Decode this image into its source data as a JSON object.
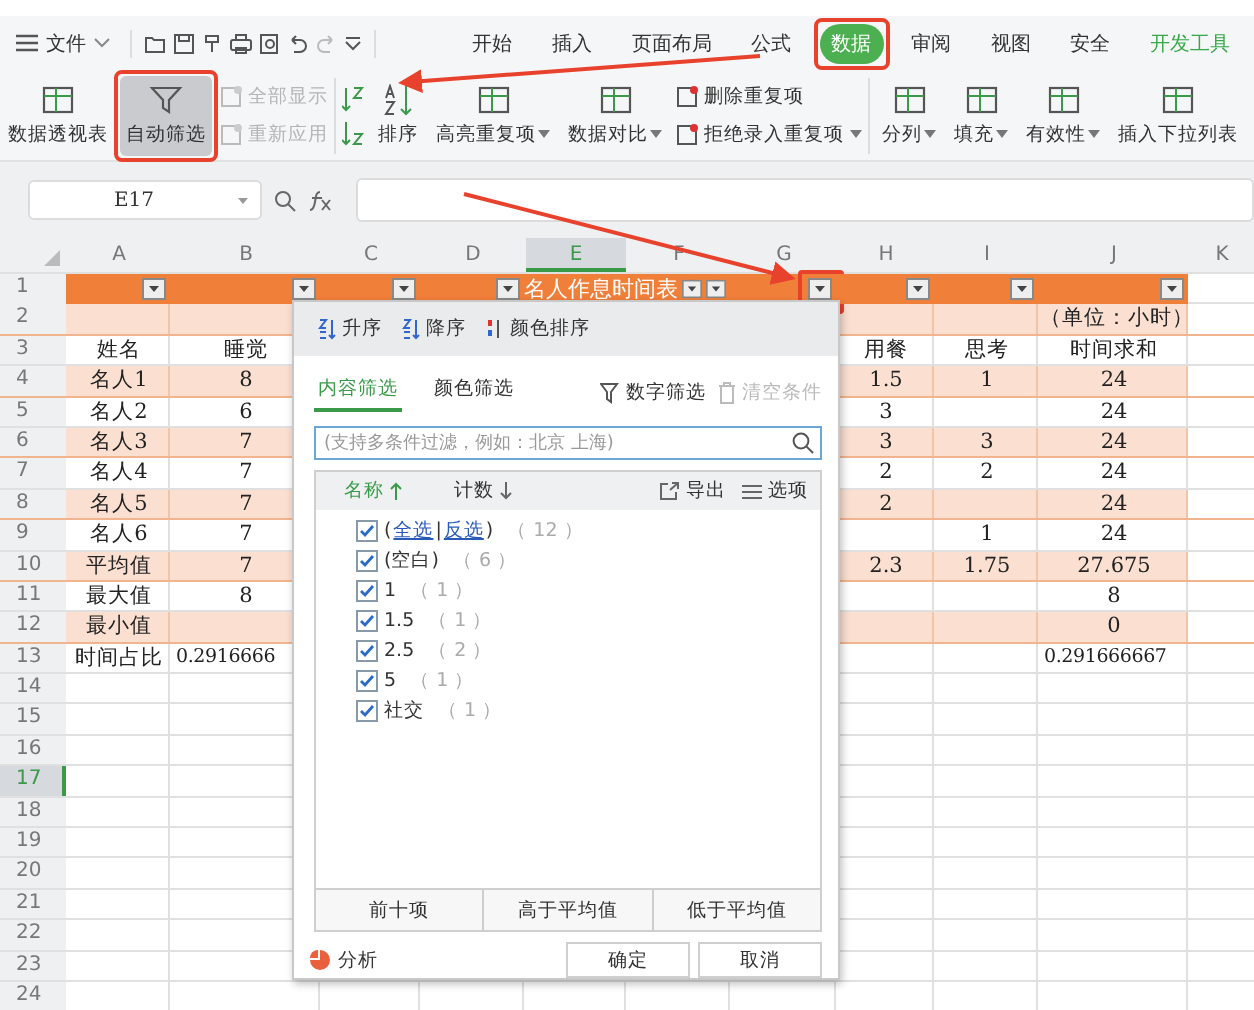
{
  "menu": {
    "label": "文件"
  },
  "tabs": [
    {
      "label": "开始",
      "selected": false,
      "kind": "normal"
    },
    {
      "label": "插入",
      "selected": false,
      "kind": "normal"
    },
    {
      "label": "页面布局",
      "selected": false,
      "kind": "normal"
    },
    {
      "label": "公式",
      "selected": false,
      "kind": "normal"
    },
    {
      "label": "数据",
      "selected": true,
      "kind": "normal"
    },
    {
      "label": "审阅",
      "selected": false,
      "kind": "normal"
    },
    {
      "label": "视图",
      "selected": false,
      "kind": "normal"
    },
    {
      "label": "安全",
      "selected": false,
      "kind": "normal"
    },
    {
      "label": "开发工具",
      "selected": false,
      "kind": "accent"
    }
  ],
  "ribbon": [
    {
      "kind": "large",
      "label": "数据透视表",
      "selected": false,
      "dropdown": false
    },
    {
      "kind": "large",
      "label": "自动筛选",
      "selected": true,
      "dropdown": false
    },
    {
      "kind": "stack",
      "items": [
        {
          "label": "全部显示",
          "disabled": true,
          "dropdown": false
        },
        {
          "label": "重新应用",
          "disabled": true,
          "dropdown": false
        }
      ]
    },
    {
      "kind": "sort",
      "label": "排序",
      "selected": false,
      "dropdown": false
    },
    {
      "kind": "large",
      "label": "高亮重复项",
      "selected": false,
      "dropdown": true
    },
    {
      "kind": "large",
      "label": "数据对比",
      "selected": false,
      "dropdown": true
    },
    {
      "kind": "stack",
      "items": [
        {
          "label": "删除重复项",
          "disabled": false,
          "dropdown": false
        },
        {
          "label": "拒绝录入重复项",
          "disabled": false,
          "dropdown": true
        }
      ]
    },
    {
      "kind": "large",
      "label": "分列",
      "selected": false,
      "dropdown": true
    },
    {
      "kind": "large",
      "label": "填充",
      "selected": false,
      "dropdown": true
    },
    {
      "kind": "large",
      "label": "有效性",
      "selected": false,
      "dropdown": true
    },
    {
      "kind": "large",
      "label": "插入下拉列表",
      "selected": false,
      "dropdown": false
    }
  ],
  "name_box": "E17",
  "sheet": {
    "columns": [
      {
        "label": "A",
        "selected": false,
        "filter": true
      },
      {
        "label": "B",
        "selected": false,
        "filter": true
      },
      {
        "label": "C",
        "selected": false,
        "filter": true
      },
      {
        "label": "D",
        "selected": false,
        "filter": true
      },
      {
        "label": "E",
        "selected": true,
        "filter": true
      },
      {
        "label": "F",
        "selected": false,
        "filter": true
      },
      {
        "label": "G",
        "selected": false,
        "filter": true
      },
      {
        "label": "H",
        "selected": false,
        "filter": true
      },
      {
        "label": "I",
        "selected": false,
        "filter": true
      },
      {
        "label": "J",
        "selected": false,
        "filter": true
      },
      {
        "label": "K",
        "selected": false,
        "filter": false
      }
    ],
    "title_row": {
      "number": "1",
      "title": "名人作息时间表"
    },
    "rows": [
      {
        "number": "2",
        "selected": false,
        "shaded": true,
        "cells": {
          "J": "（单位：小时）"
        }
      },
      {
        "number": "3",
        "selected": false,
        "shaded": false,
        "cells": {
          "A": "姓名",
          "B": "睡觉",
          "H": "用餐",
          "I": "思考",
          "J": "时间求和"
        }
      },
      {
        "number": "4",
        "selected": false,
        "shaded": true,
        "cells": {
          "A": "名人1",
          "B": "8",
          "H": "1.5",
          "I": "1",
          "J": "24"
        }
      },
      {
        "number": "5",
        "selected": false,
        "shaded": false,
        "cells": {
          "A": "名人2",
          "B": "6",
          "H": "3",
          "J": "24"
        }
      },
      {
        "number": "6",
        "selected": false,
        "shaded": true,
        "cells": {
          "A": "名人3",
          "B": "7",
          "H": "3",
          "I": "3",
          "J": "24"
        }
      },
      {
        "number": "7",
        "selected": false,
        "shaded": false,
        "cells": {
          "A": "名人4",
          "B": "7",
          "H": "2",
          "I": "2",
          "J": "24"
        }
      },
      {
        "number": "8",
        "selected": false,
        "shaded": true,
        "cells": {
          "A": "名人5",
          "B": "7",
          "H": "2",
          "J": "24"
        }
      },
      {
        "number": "9",
        "selected": false,
        "shaded": false,
        "cells": {
          "A": "名人6",
          "B": "7",
          "I": "1",
          "J": "24"
        }
      },
      {
        "number": "10",
        "selected": false,
        "shaded": true,
        "cells": {
          "A": "平均值",
          "B": "7",
          "H": "2.3",
          "I": "1.75",
          "J": "27.675"
        }
      },
      {
        "number": "11",
        "selected": false,
        "shaded": false,
        "cells": {
          "A": "最大值",
          "B": "8",
          "J": "8"
        }
      },
      {
        "number": "12",
        "selected": false,
        "shaded": true,
        "cells": {
          "A": "最小值",
          "J": "0"
        }
      },
      {
        "number": "13",
        "selected": false,
        "shaded": false,
        "cells": {
          "A": "时间占比",
          "B": "0.2916666",
          "J": "0.291666667"
        }
      },
      {
        "number": "14",
        "selected": false,
        "shaded": false,
        "cells": {}
      },
      {
        "number": "15",
        "selected": false,
        "shaded": false,
        "cells": {}
      },
      {
        "number": "16",
        "selected": false,
        "shaded": false,
        "cells": {}
      },
      {
        "number": "17",
        "selected": true,
        "shaded": false,
        "cells": {}
      },
      {
        "number": "18",
        "selected": false,
        "shaded": false,
        "cells": {}
      },
      {
        "number": "19",
        "selected": false,
        "shaded": false,
        "cells": {}
      },
      {
        "number": "20",
        "selected": false,
        "shaded": false,
        "cells": {}
      },
      {
        "number": "21",
        "selected": false,
        "shaded": false,
        "cells": {}
      },
      {
        "number": "22",
        "selected": false,
        "shaded": false,
        "cells": {}
      },
      {
        "number": "23",
        "selected": false,
        "shaded": false,
        "cells": {}
      },
      {
        "number": "24",
        "selected": false,
        "shaded": false,
        "cells": {}
      }
    ]
  },
  "filter_panel": {
    "sort": [
      "升序",
      "降序",
      "颜色排序"
    ],
    "tabs": [
      {
        "label": "内容筛选",
        "selected": true
      },
      {
        "label": "颜色筛选",
        "selected": false
      }
    ],
    "actions": [
      {
        "label": "数字筛选",
        "disabled": false
      },
      {
        "label": "清空条件",
        "disabled": true
      }
    ],
    "search": {
      "placeholder": "(支持多条件过滤，例如：北京 上海)"
    },
    "list_columns": [
      {
        "label": "名称",
        "selected": true
      },
      {
        "label": "计数",
        "selected": false
      }
    ],
    "list_tools": [
      "导出",
      "选项"
    ],
    "items": [
      {
        "kind": "select_all",
        "checked": true,
        "prefix": "(",
        "links": [
          "全选",
          "反选"
        ],
        "separator": "|",
        "suffix": ")",
        "count": "（ 12 ）"
      },
      {
        "kind": "value",
        "checked": true,
        "label": "(空白)",
        "count": "（ 6 ）"
      },
      {
        "kind": "value",
        "checked": true,
        "label": "1",
        "count": "（ 1 ）"
      },
      {
        "kind": "value",
        "checked": true,
        "label": "1.5",
        "count": "（ 1 ）"
      },
      {
        "kind": "value",
        "checked": true,
        "label": "2.5",
        "count": "（ 2 ）"
      },
      {
        "kind": "value",
        "checked": true,
        "label": "5",
        "count": "（ 1 ）"
      },
      {
        "kind": "value",
        "checked": true,
        "label": "社交",
        "count": "（ 1 ）"
      }
    ],
    "quick_filters": [
      "前十项",
      "高于平均值",
      "低于平均值"
    ],
    "analyze": "分析",
    "buttons": [
      "确定",
      "取消"
    ]
  }
}
